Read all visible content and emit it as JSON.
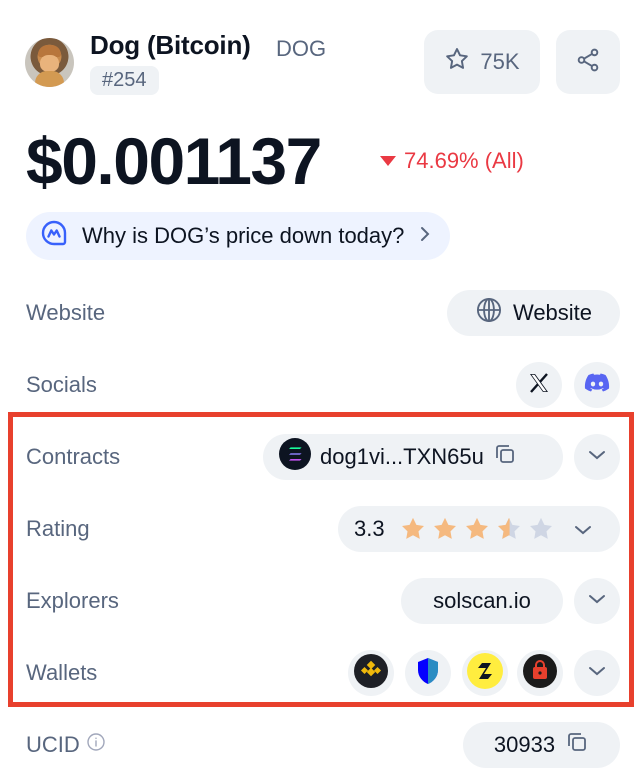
{
  "coin": {
    "name": "Dog (Bitcoin)",
    "symbol": "DOG",
    "rank": "#254",
    "watchlist_count": "75K",
    "price": "$0.001137",
    "change": "74.69% (All)",
    "why_prompt": "Why is DOG’s price down today?"
  },
  "rows": {
    "website": {
      "label": "Website",
      "button": "Website"
    },
    "socials": {
      "label": "Socials"
    },
    "contracts": {
      "label": "Contracts",
      "address": "dog1vi...TXN65u"
    },
    "rating": {
      "label": "Rating",
      "value": "3.3",
      "stars_filled": 3.3,
      "stars_total": 5
    },
    "explorers": {
      "label": "Explorers",
      "value": "solscan.io"
    },
    "wallets": {
      "label": "Wallets"
    },
    "ucid": {
      "label": "UCID",
      "value": "30933"
    }
  },
  "colors": {
    "accent_red": "#ea3943",
    "highlight_border": "#e8402d",
    "star_filled": "#f5b97f",
    "star_empty": "#cfd6e4",
    "discord": "#5865f2"
  },
  "icons": [
    "star-outline-icon",
    "share-icon",
    "ai-chat-icon",
    "chevron-right-icon",
    "globe-icon",
    "x-logo-icon",
    "discord-icon",
    "solana-icon",
    "copy-icon",
    "chevron-down-icon",
    "info-icon",
    "binance-wallet-icon",
    "trust-wallet-icon",
    "safepal-wallet-icon",
    "bitget-wallet-icon"
  ]
}
